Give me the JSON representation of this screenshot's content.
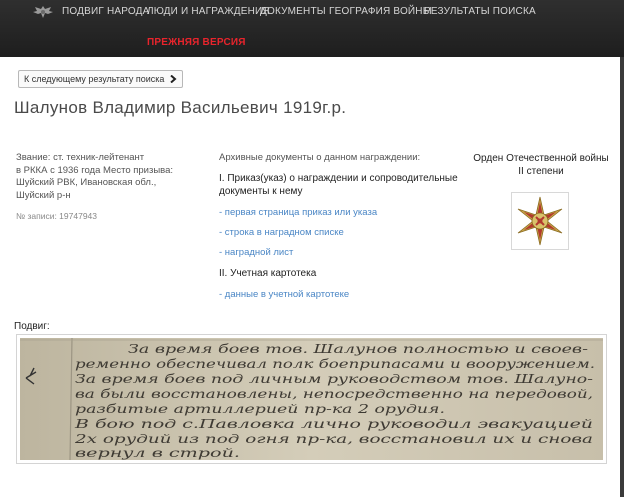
{
  "nav": {
    "items": [
      "ПОДВИГ НАРОДА",
      "ЛЮДИ И НАГРАЖДЕНИЯ",
      "ДОКУМЕНТЫ",
      "ГЕОГРАФИЯ ВОЙНЫ",
      "РЕЗУЛЬТАТЫ ПОИСКА"
    ],
    "old_version": "ПРЕЖНЯЯ ВЕРСИЯ",
    "logo_icon": "eagle-emblem-icon"
  },
  "content": {
    "next_button": "К следующему результату поиска",
    "title": "Шалунов Владимир Васильевич 1919г.р.",
    "info_lines": [
      "Звание: ст. техник-лейтенант",
      "в РККА с 1936 года Место призыва:",
      "Шуйский РВК, Ивановская обл.,",
      "Шуйский р-н"
    ],
    "record": "№ записи: 19747943",
    "docs": {
      "header": "Архивные документы о данном награждении:",
      "section1": "I. Приказ(указ) о награждении и сопроводительные документы к нему",
      "links1": [
        "- первая страница приказ или указа",
        "- строка в наградном списке",
        "- наградной лист"
      ],
      "section2": "II. Учетная картотека",
      "links2": [
        "- данные в учетной картотеке"
      ]
    },
    "award": {
      "name_line1": "Орден Отечественной войны",
      "name_line2": "II степени",
      "icon": "order-patriotic-war-icon"
    },
    "feat": {
      "label": "Подвиг:",
      "handwriting": [
        "За время боев тов. Шалунов полностью и своев-",
        "ременно обеспечивал полк боеприпасами и вооружением.",
        "За время боев под личным руководством тов. Шалуно-",
        "ва были восстановлены, непосредственно на передовой,",
        "разбитые артиллерией пр-ка 2 орудия.",
        "В бою под с.Павловка лично руководил эвакуацией",
        "2х орудий из под огня пр-ка, восстановил их и снова",
        "вернул в строй."
      ]
    }
  }
}
